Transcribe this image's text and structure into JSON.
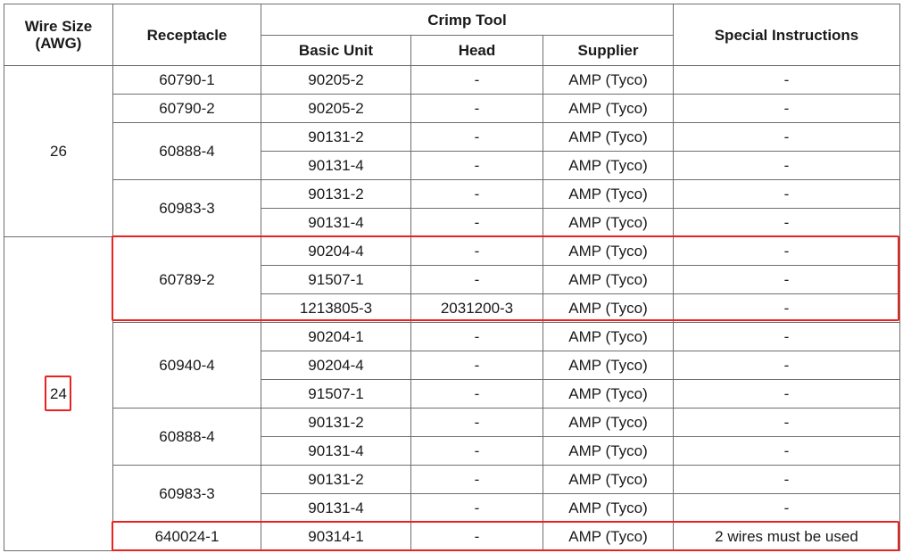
{
  "header": {
    "wire_size": "Wire Size\n(AWG)",
    "receptacle": "Receptacle",
    "crimp_tool": "Crimp Tool",
    "basic_unit": "Basic Unit",
    "head": "Head",
    "supplier": "Supplier",
    "special": "Special Instructions"
  },
  "groups": [
    {
      "wire": "26",
      "receptacles": [
        {
          "name": "60790-1",
          "rows": [
            {
              "basic": "90205-2",
              "head": "-",
              "supplier": "AMP (Tyco)",
              "special": "-"
            }
          ]
        },
        {
          "name": "60790-2",
          "rows": [
            {
              "basic": "90205-2",
              "head": "-",
              "supplier": "AMP (Tyco)",
              "special": "-"
            }
          ]
        },
        {
          "name": "60888-4",
          "rows": [
            {
              "basic": "90131-2",
              "head": "-",
              "supplier": "AMP (Tyco)",
              "special": "-"
            },
            {
              "basic": "90131-4",
              "head": "-",
              "supplier": "AMP (Tyco)",
              "special": "-"
            }
          ]
        },
        {
          "name": "60983-3",
          "rows": [
            {
              "basic": "90131-2",
              "head": "-",
              "supplier": "AMP (Tyco)",
              "special": "-"
            },
            {
              "basic": "90131-4",
              "head": "-",
              "supplier": "AMP (Tyco)",
              "special": "-"
            }
          ]
        }
      ]
    },
    {
      "wire": "24",
      "receptacles": [
        {
          "name": "60789-2",
          "rows": [
            {
              "basic": "90204-4",
              "head": "-",
              "supplier": "AMP (Tyco)",
              "special": "-"
            },
            {
              "basic": "91507-1",
              "head": "-",
              "supplier": "AMP (Tyco)",
              "special": "-"
            },
            {
              "basic": "1213805-3",
              "head": "2031200-3",
              "supplier": "AMP (Tyco)",
              "special": "-"
            }
          ]
        },
        {
          "name": "60940-4",
          "rows": [
            {
              "basic": "90204-1",
              "head": "-",
              "supplier": "AMP (Tyco)",
              "special": "-"
            },
            {
              "basic": "90204-4",
              "head": "-",
              "supplier": "AMP (Tyco)",
              "special": "-"
            },
            {
              "basic": "91507-1",
              "head": "-",
              "supplier": "AMP (Tyco)",
              "special": "-"
            }
          ]
        },
        {
          "name": "60888-4",
          "rows": [
            {
              "basic": "90131-2",
              "head": "-",
              "supplier": "AMP (Tyco)",
              "special": "-"
            },
            {
              "basic": "90131-4",
              "head": "-",
              "supplier": "AMP (Tyco)",
              "special": "-"
            }
          ]
        },
        {
          "name": "60983-3",
          "rows": [
            {
              "basic": "90131-2",
              "head": "-",
              "supplier": "AMP (Tyco)",
              "special": "-"
            },
            {
              "basic": "90131-4",
              "head": "-",
              "supplier": "AMP (Tyco)",
              "special": "-"
            }
          ]
        },
        {
          "name": "640024-1",
          "rows": [
            {
              "basic": "90314-1",
              "head": "-",
              "supplier": "AMP (Tyco)",
              "special": "2 wires must be used"
            }
          ]
        }
      ]
    }
  ],
  "highlight_color": "#e8231f"
}
